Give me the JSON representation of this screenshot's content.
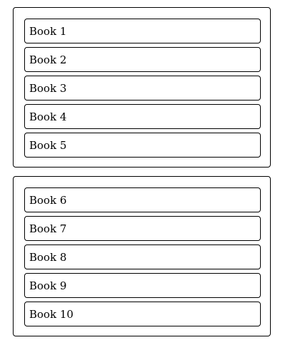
{
  "panels": [
    {
      "items": [
        {
          "label": "Book 1"
        },
        {
          "label": "Book 2"
        },
        {
          "label": "Book 3"
        },
        {
          "label": "Book 4"
        },
        {
          "label": "Book 5"
        }
      ]
    },
    {
      "items": [
        {
          "label": "Book 6"
        },
        {
          "label": "Book 7"
        },
        {
          "label": "Book 8"
        },
        {
          "label": "Book 9"
        },
        {
          "label": "Book 10"
        }
      ]
    }
  ]
}
